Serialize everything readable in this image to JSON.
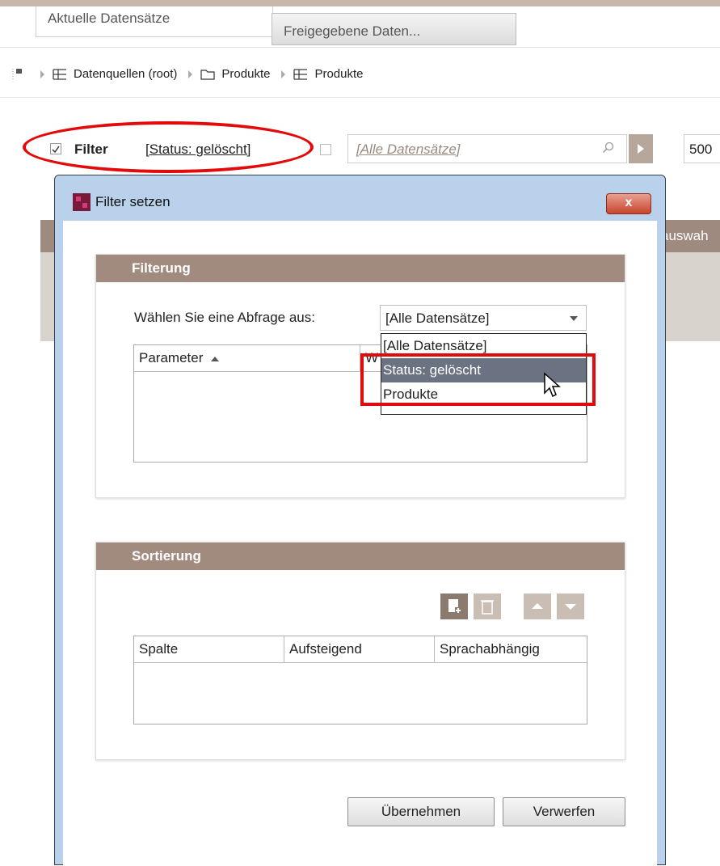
{
  "tabs": {
    "current": "Aktuelle Datensätze",
    "shared": "Freigegebene Daten..."
  },
  "breadcrumb": {
    "items": [
      {
        "label": "Datenquellen (root)",
        "icon": "table-icon"
      },
      {
        "label": "Produkte",
        "icon": "folder-icon"
      },
      {
        "label": "Produkte",
        "icon": "table-icon"
      }
    ]
  },
  "filterbar": {
    "filter_label": "Filter",
    "filter_checked": true,
    "filter_status": "[Status: gelöscht]",
    "search_placeholder": "[Alle Datensätze]",
    "page_size": "500"
  },
  "background": {
    "column_label": "auswah"
  },
  "dialog": {
    "title": "Filter setzen",
    "close_label": "x",
    "filtering": {
      "header": "Filterung",
      "query_label": "Wählen Sie eine Abfrage aus:",
      "selected_value": "[Alle Datensätze]",
      "options": [
        "[Alle Datensätze]",
        "Status: gelöscht",
        "Produkte"
      ],
      "highlighted_option": "Status: gelöscht",
      "param_column": "Parameter",
      "second_column": "W"
    },
    "sorting": {
      "header": "Sortierung",
      "columns": [
        "Spalte",
        "Aufsteigend",
        "Sprachabhängig"
      ]
    },
    "apply_label": "Übernehmen",
    "discard_label": "Verwerfen"
  },
  "colors": {
    "accent": "#a08b7e",
    "highlight": "#e20a0a",
    "selection": "#6b7382"
  }
}
